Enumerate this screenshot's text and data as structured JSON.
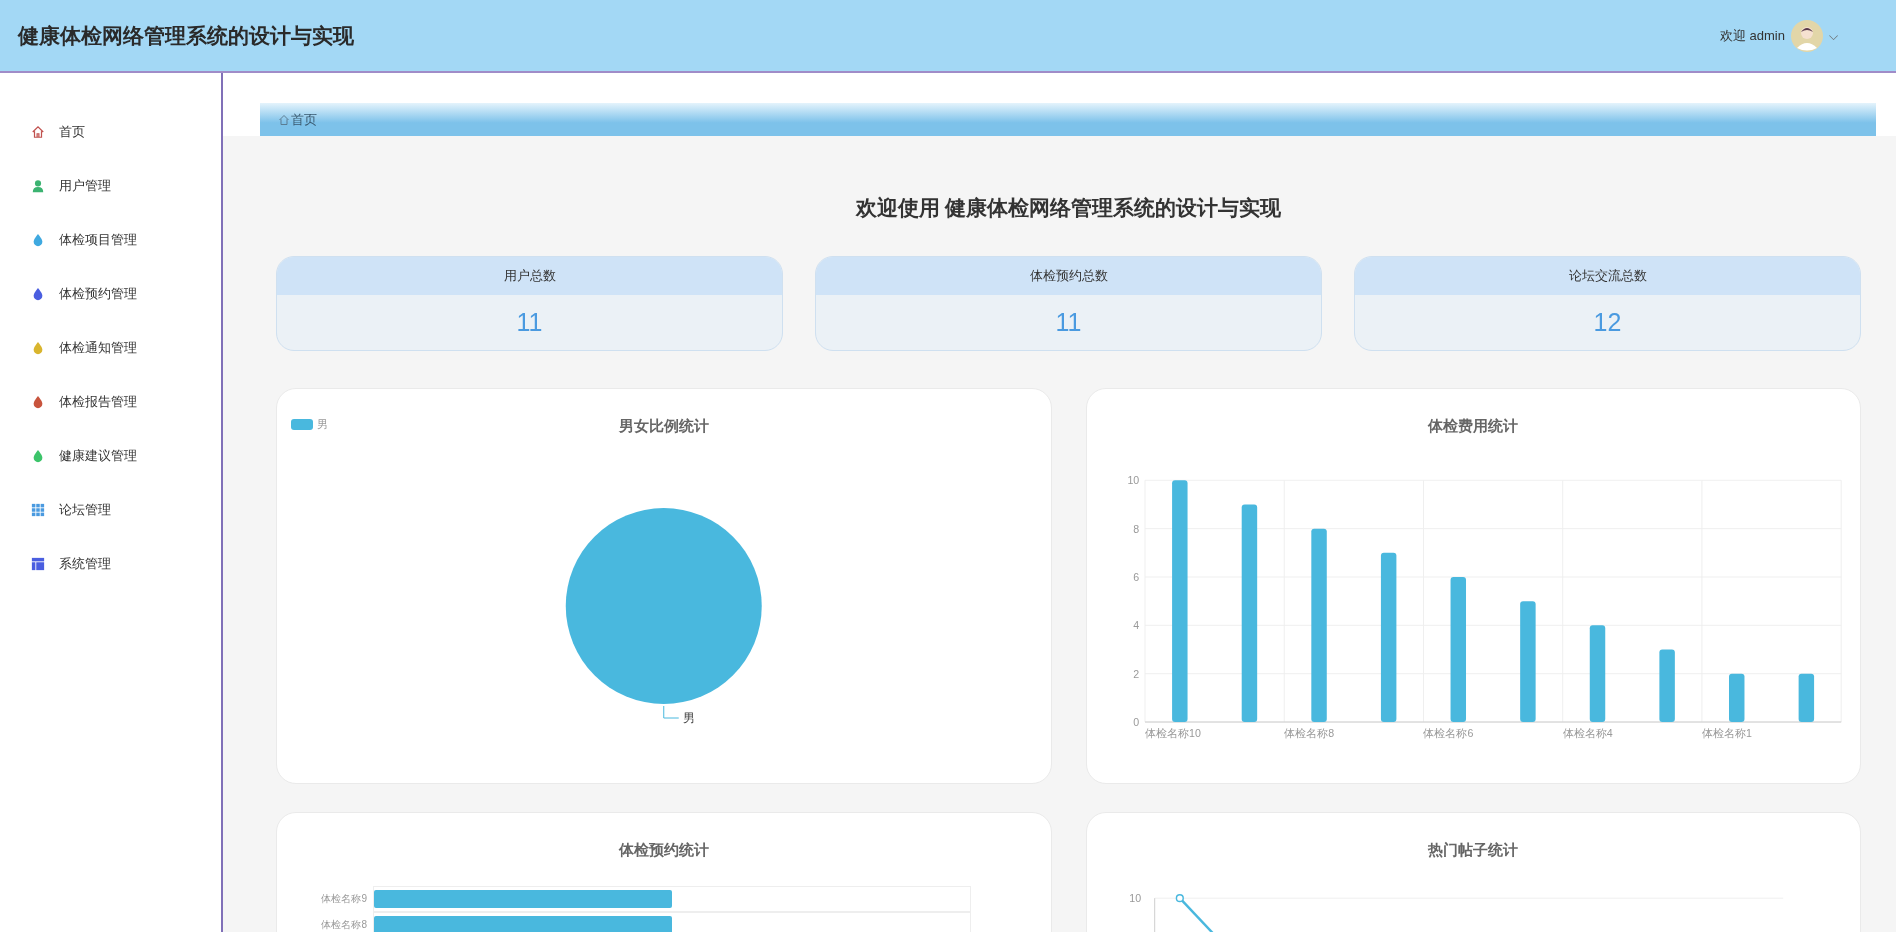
{
  "header": {
    "title": "健康体检网络管理系统的设计与实现",
    "greeting": "欢迎 admin",
    "dropdown_caret": "⌵"
  },
  "sidebar": {
    "items": [
      {
        "label": "首页",
        "color": "#c0504d"
      },
      {
        "label": "用户管理",
        "color": "#3cb371"
      },
      {
        "label": "体检项目管理",
        "color": "#3fa9e0"
      },
      {
        "label": "体检预约管理",
        "color": "#4a5ee0"
      },
      {
        "label": "体检通知管理",
        "color": "#d9b52e"
      },
      {
        "label": "体检报告管理",
        "color": "#c8543d"
      },
      {
        "label": "健康建议管理",
        "color": "#3cc46a"
      },
      {
        "label": "论坛管理",
        "color": "#4a9ae0"
      },
      {
        "label": "系统管理",
        "color": "#4a5ee0"
      }
    ]
  },
  "breadcrumb": {
    "label": "首页"
  },
  "welcome": "欢迎使用 健康体检网络管理系统的设计与实现",
  "stats": [
    {
      "label": "用户总数",
      "value": "11"
    },
    {
      "label": "体检预约总数",
      "value": "11"
    },
    {
      "label": "论坛交流总数",
      "value": "12"
    }
  ],
  "charts": [
    {
      "title": "男女比例统计",
      "chart_data": {
        "type": "pie",
        "categories": [
          "男"
        ],
        "series": [
          {
            "name": "男",
            "color": "#49b8de",
            "values": [
              1
            ]
          }
        ]
      }
    },
    {
      "title": "体检费用统计",
      "chart_data": {
        "type": "bar",
        "categories": [
          "体检名称10",
          null,
          "体检名称8",
          null,
          "体检名称6",
          null,
          "体检名称4",
          null,
          "体检名称1",
          null
        ],
        "series": [
          {
            "color": "#49b8de",
            "values": [
              10,
              9,
              8,
              7,
              6,
              5,
              4,
              3,
              2,
              2
            ]
          }
        ],
        "ylim": [
          0,
          10
        ],
        "yticks": [
          0,
          2,
          4,
          6,
          8,
          10
        ],
        "grid": true
      }
    },
    {
      "title": "体检预约统计",
      "kind": "hbar",
      "category_labels": [
        "体检名称9",
        "体检名称8"
      ]
    },
    {
      "title": "热门帖子统计",
      "kind": "line",
      "y_tick_labels": [
        "10"
      ]
    }
  ]
}
